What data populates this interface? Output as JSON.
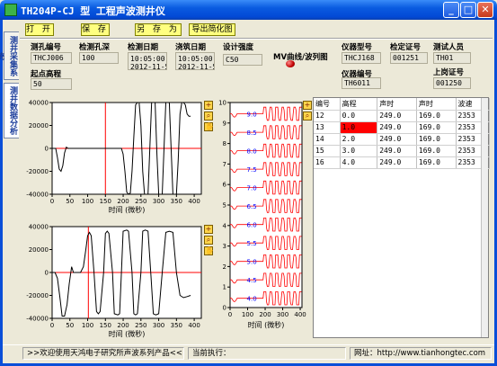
{
  "window": {
    "title": "TH204P-CJ 型 工程声波测井仪",
    "minimize": "_",
    "maximize": "□",
    "close": "✕"
  },
  "side_tabs": [
    "测井采集系统",
    "测井数据分析"
  ],
  "toolbar": {
    "open": "打 开",
    "save": "保 存",
    "save_as": "另 存 为",
    "export_simple": "导出简化图"
  },
  "fields": {
    "hole_id_label": "测孔编号",
    "hole_id": "THCJ006",
    "start_elev_label": "起点高程",
    "start_elev": "50",
    "hole_depth_label": "检测孔深",
    "hole_depth": "100",
    "test_date_label": "检测日期",
    "test_date": "10:05:00.\n2012-11-5",
    "pour_date_label": "浇筑日期",
    "pour_date": "10:05:00.\n2012-11-5",
    "strength_label": "设计强度",
    "strength": "C50",
    "curve_label": "MV曲线/波列图",
    "instr_model_label": "仪器型号",
    "instr_model": "THCJ168",
    "instr_no_label": "仪器编号",
    "instr_no": "TH6011",
    "cert_label": "检定证号",
    "cert": "001251",
    "tester_label": "测试人员",
    "tester": "TH01",
    "post_cert_label": "上岗证号",
    "post_cert": "001250"
  },
  "chart_data": [
    {
      "type": "line",
      "name": "upper waveform",
      "xlabel": "时间 (微秒)",
      "ylabel": "",
      "xlim": [
        0,
        420
      ],
      "ylim": [
        -40000,
        40000
      ],
      "xticks": [
        0,
        50,
        100,
        150,
        200,
        250,
        300,
        350,
        400
      ],
      "yticks": [
        40000,
        20000,
        0,
        -20000,
        -40000
      ],
      "cursor_x": 150,
      "series": [
        {
          "x": [
            0,
            10,
            15,
            20,
            25,
            30,
            35,
            40,
            45,
            55,
            160,
            195,
            200,
            205,
            210,
            215,
            220,
            225,
            230,
            235,
            240,
            245,
            250,
            255,
            260,
            265,
            270,
            275,
            280,
            285,
            290,
            295,
            300,
            305,
            310,
            315,
            320,
            325,
            330,
            335,
            340,
            345,
            350,
            355,
            360,
            365,
            370,
            375,
            380,
            385,
            390
          ],
          "y": [
            0,
            0,
            -8000,
            -18000,
            -20000,
            -15000,
            -4000,
            1000,
            0,
            0,
            0,
            0,
            -5000,
            -20000,
            -38000,
            -40000,
            -39000,
            -20000,
            10000,
            38000,
            40000,
            40000,
            20000,
            -20000,
            -40000,
            -40000,
            -40000,
            0,
            40000,
            40000,
            40000,
            -5000,
            -40000,
            -40000,
            -40000,
            0,
            40000,
            40000,
            40000,
            0,
            -40000,
            -40000,
            -40000,
            -10000,
            30000,
            40000,
            40000,
            38000,
            30000,
            28000,
            28000
          ]
        }
      ]
    },
    {
      "type": "line",
      "name": "lower waveform",
      "xlabel": "时间 (微秒)",
      "ylabel": "",
      "xlim": [
        0,
        420
      ],
      "ylim": [
        -40000,
        40000
      ],
      "xticks": [
        0,
        50,
        100,
        150,
        200,
        250,
        300,
        350,
        400
      ],
      "yticks": [
        40000,
        20000,
        0,
        -20000,
        -40000
      ],
      "cursor_x": 102,
      "series": [
        {
          "x": [
            0,
            8,
            15,
            22,
            28,
            35,
            42,
            48,
            55,
            60,
            70,
            80,
            88,
            95,
            100,
            105,
            110,
            118,
            125,
            130,
            135,
            145,
            150,
            155,
            160,
            170,
            175,
            185,
            190,
            195,
            200,
            210,
            215,
            225,
            230,
            235,
            240,
            250,
            255,
            262,
            270,
            278,
            285,
            292,
            300,
            310,
            320,
            330,
            340,
            350,
            360,
            370,
            380,
            390
          ],
          "y": [
            0,
            0,
            -5000,
            -22000,
            -38000,
            -38000,
            -28000,
            -10000,
            5000,
            0,
            0,
            0,
            5000,
            20000,
            32000,
            35000,
            32000,
            0,
            -34000,
            -36000,
            -34000,
            0,
            34000,
            36000,
            34000,
            0,
            -36000,
            -37000,
            -36000,
            0,
            36000,
            37000,
            36000,
            0,
            -36000,
            -37000,
            -36000,
            0,
            36000,
            37000,
            36000,
            -2000,
            -36000,
            -37000,
            -36000,
            0,
            35000,
            36000,
            35000,
            0,
            -20000,
            -22000,
            -21000,
            -20000
          ]
        }
      ]
    },
    {
      "type": "line",
      "name": "wave train",
      "xlabel": "时间 (微秒)",
      "ylabel": "",
      "xlim": [
        0,
        410
      ],
      "ylim": [
        0,
        10
      ],
      "xticks": [
        0,
        100,
        200,
        300,
        400
      ],
      "yticks": [
        10,
        9,
        8,
        7,
        6,
        5,
        4,
        3,
        2,
        1,
        0
      ],
      "trace_labels": [
        "9.0",
        "8.5",
        "8.0",
        "7.5",
        "7.0",
        "6.5",
        "6.0",
        "5.5",
        "5.0",
        "4.5",
        "4.0"
      ]
    }
  ],
  "table": {
    "headers": [
      "编号",
      "高程",
      "声时",
      "声时",
      "波速"
    ],
    "rows": [
      [
        "12",
        "0.0",
        "249.0",
        "169.0",
        "2353"
      ],
      [
        "13",
        "1.0",
        "249.0",
        "169.0",
        "2353"
      ],
      [
        "14",
        "2.0",
        "249.0",
        "169.0",
        "2353"
      ],
      [
        "15",
        "3.0",
        "249.0",
        "169.0",
        "2353"
      ],
      [
        "16",
        "4.0",
        "249.0",
        "169.0",
        "2353"
      ]
    ],
    "highlight_row": 1,
    "highlight_col": 1,
    "highlight_color": "#FF0000"
  },
  "status": {
    "welcome": ">>欢迎使用天鸿电子研究所声波系列产品<<",
    "current_exec": "当前执行：",
    "website": "网址：http://www.tianhongtec.com"
  },
  "colors": {
    "title_bar": "#0A5BE0",
    "toolbar_button": "#FFFF80",
    "wave_trace": "#000000",
    "zero_line": "#FF0000",
    "cursor_line": "#FF0000",
    "train_trace": "#FF0000",
    "train_labels": "#0000FF",
    "led": "#C00000"
  }
}
